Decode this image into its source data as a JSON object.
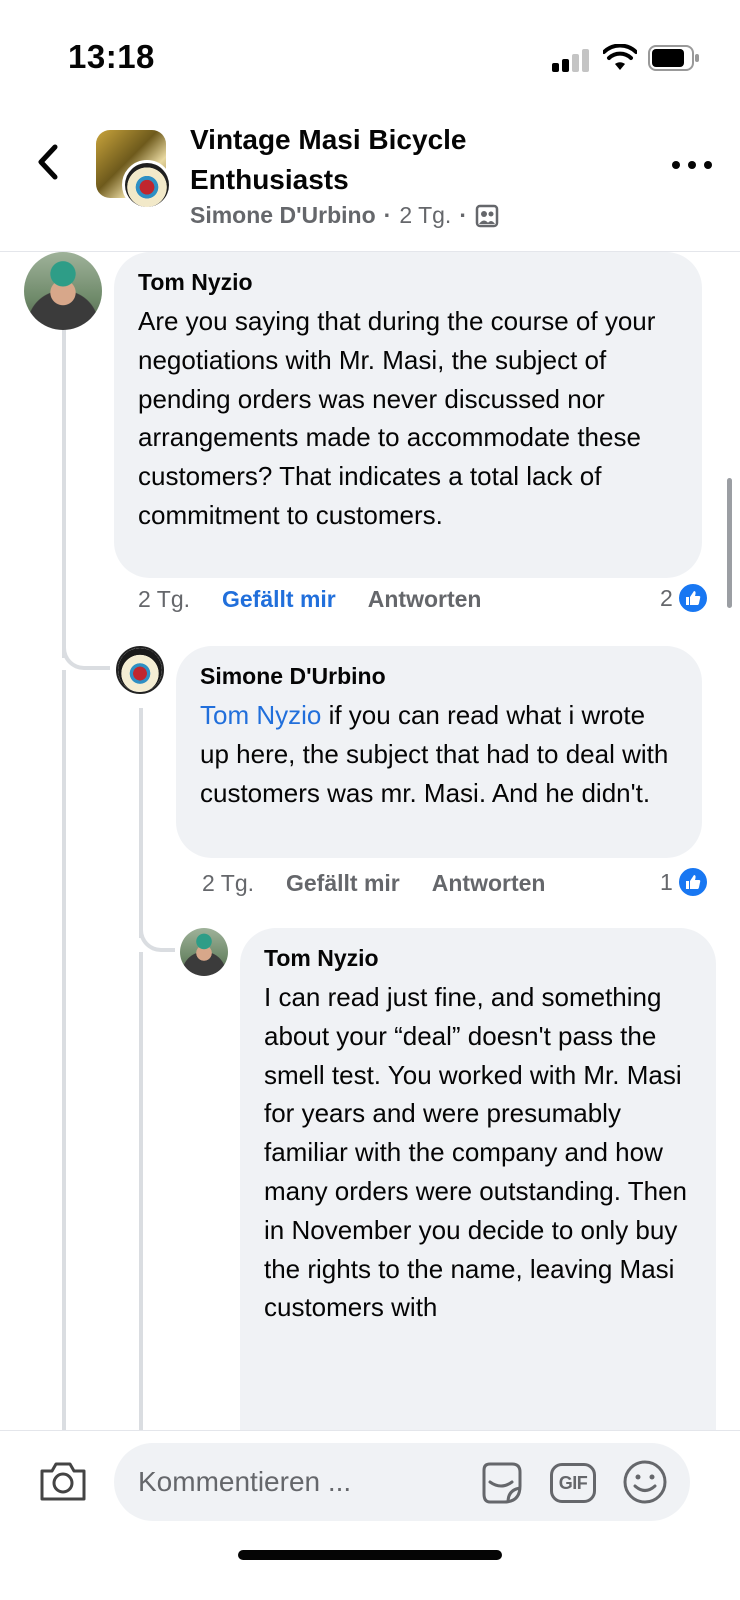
{
  "status_bar": {
    "time": "13:18"
  },
  "header": {
    "group_name": "Vintage Masi Bicycle Enthusiasts",
    "author": "Simone D'Urbino",
    "separator": "·",
    "post_age": "2 Tg.",
    "icons": {
      "back": "chevron-left-icon",
      "more": "more-dots-icon",
      "audience": "group-audience-icon"
    }
  },
  "comments": [
    {
      "author": "Tom Nyzio",
      "text": "Are you saying that during the course of your negotiations with Mr. Masi, the subject of pending orders was never discussed nor arrangements made to accommodate these customers?  That indicates a total lack of commitment to customers.",
      "age": "2 Tg.",
      "like_label": "Gefällt mir",
      "like_active": true,
      "reply_label": "Antworten",
      "reaction_count": "2"
    },
    {
      "author": "Simone D'Urbino",
      "mention": "Tom Nyzio",
      "text": " if you can read what i wrote up here, the subject that had to deal with customers was mr. Masi.  And he didn't.",
      "age": "2 Tg.",
      "like_label": "Gefällt mir",
      "like_active": false,
      "reply_label": "Antworten",
      "reaction_count": "1"
    },
    {
      "author": "Tom Nyzio",
      "text": "I can read just fine, and something about your “deal” doesn't pass the smell test.  You worked with Mr. Masi for years and were presumably familiar with the company and how many orders were outstanding.  Then in November you decide to only buy the rights to the name, leaving Masi customers with"
    }
  ],
  "composer": {
    "placeholder": "Kommentieren ...",
    "gif_label": "GIF",
    "icons": {
      "camera": "camera-icon",
      "sticker": "sticker-icon",
      "gif": "gif-icon",
      "emoji": "emoji-icon"
    }
  },
  "colors": {
    "link": "#216fdb",
    "bubble": "#f0f2f5",
    "like": "#1877f2",
    "meta": "#65676b"
  }
}
